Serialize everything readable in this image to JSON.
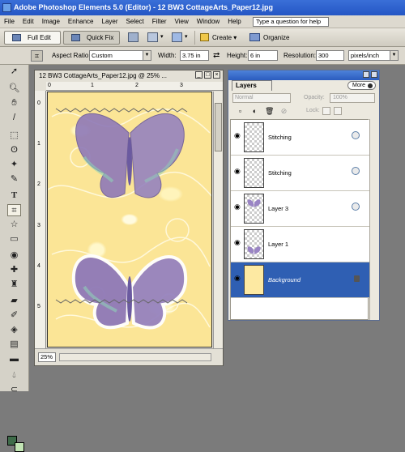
{
  "app": {
    "title": "Adobe Photoshop Elements 5.0 (Editor) - 12 BW3 CottageArts_Paper12.jpg"
  },
  "menu": [
    "File",
    "Edit",
    "Image",
    "Enhance",
    "Layer",
    "Select",
    "Filter",
    "View",
    "Window",
    "Help"
  ],
  "help": {
    "placeholder": "Type a question for help"
  },
  "shortcuts": {
    "full_edit": "Full Edit",
    "quick_fix": "Quick Fix",
    "create": "Create",
    "organize": "Organize"
  },
  "options": {
    "aspect_label": "Aspect Ratio:",
    "aspect_value": "Custom",
    "width_label": "Width:",
    "width_value": "3.75 in",
    "height_label": "Height:",
    "height_value": "6 in",
    "resolution_label": "Resolution:",
    "resolution_value": "300",
    "resolution_unit": "pixels/inch"
  },
  "document": {
    "title": "12 BW3 CottageArts_Paper12.jpg @ 25% ...",
    "zoom": "25%",
    "ruler_top": [
      "0",
      "1",
      "2",
      "3"
    ],
    "ruler_left": [
      "0",
      "1",
      "2",
      "3",
      "4",
      "5"
    ]
  },
  "layers": {
    "tab": "Layers",
    "more": "More",
    "blend": "Normal",
    "opacity_label": "Opacity:",
    "opacity_value": "100%",
    "lock_label": "Lock:",
    "items": [
      {
        "name": "Stitching",
        "type": "transparent"
      },
      {
        "name": "Stitching",
        "type": "transparent"
      },
      {
        "name": "Layer 3",
        "type": "butterfly"
      },
      {
        "name": "Layer 1",
        "type": "butterfly"
      },
      {
        "name": "Background",
        "type": "background",
        "selected": true
      }
    ]
  },
  "colors": {
    "foreground": "#3e6b49",
    "background": "#c2e4b4",
    "selection": "#2f5fb3"
  }
}
